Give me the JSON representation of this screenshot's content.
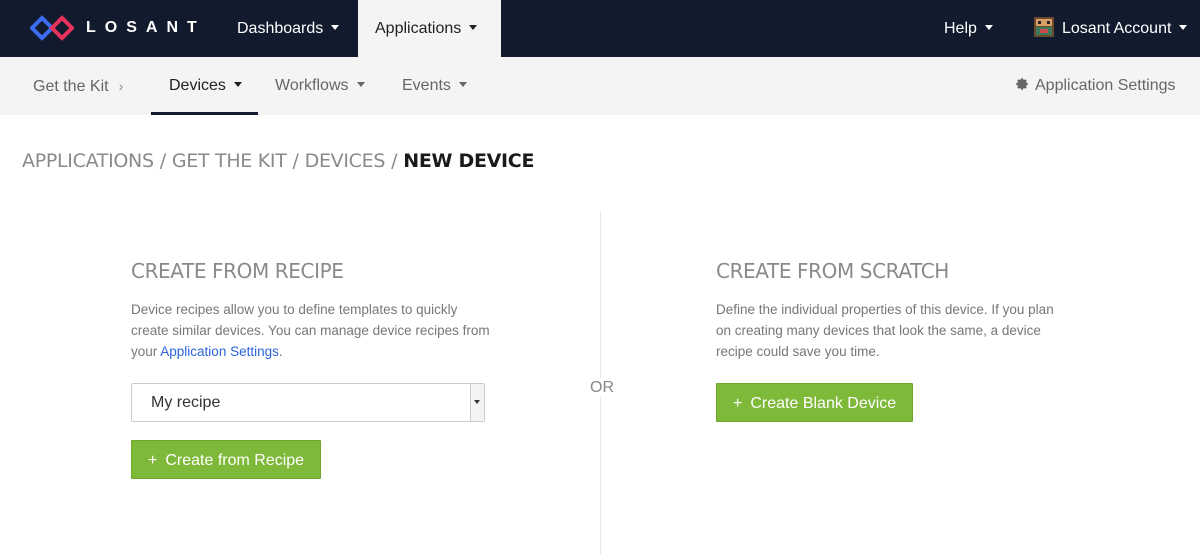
{
  "topnav": {
    "brand": "LOSANT",
    "dashboards": "Dashboards",
    "applications": "Applications",
    "help": "Help",
    "account": "Losant Account"
  },
  "subnav": {
    "get_the_kit": "Get the Kit",
    "devices": "Devices",
    "workflows": "Workflows",
    "events": "Events",
    "app_settings": "Application Settings"
  },
  "breadcrumb": {
    "applications": "APPLICATIONS",
    "get_the_kit": "GET THE KIT",
    "devices": "DEVICES",
    "current": "NEW DEVICE",
    "separator": "/"
  },
  "recipe": {
    "title": "CREATE FROM RECIPE",
    "desc_before": "Device recipes allow you to define templates to quickly create similar devices. You can manage device recipes from your ",
    "desc_link": "Application Settings",
    "desc_after": ".",
    "select_value": "My recipe",
    "button": "Create from Recipe"
  },
  "or_label": "OR",
  "scratch": {
    "title": "CREATE FROM SCRATCH",
    "desc": "Define the individual properties of this device. If you plan on creating many devices that look the same, a device recipe could save you time.",
    "button": "Create Blank Device"
  },
  "colors": {
    "topbar": "#121a2d",
    "accent_green": "#7fb93a",
    "link_blue": "#2a64d8"
  },
  "icons": {
    "logo": "losant-logo-icon",
    "gear": "gear-icon",
    "avatar": "account-avatar-icon",
    "plus": "plus-icon"
  }
}
